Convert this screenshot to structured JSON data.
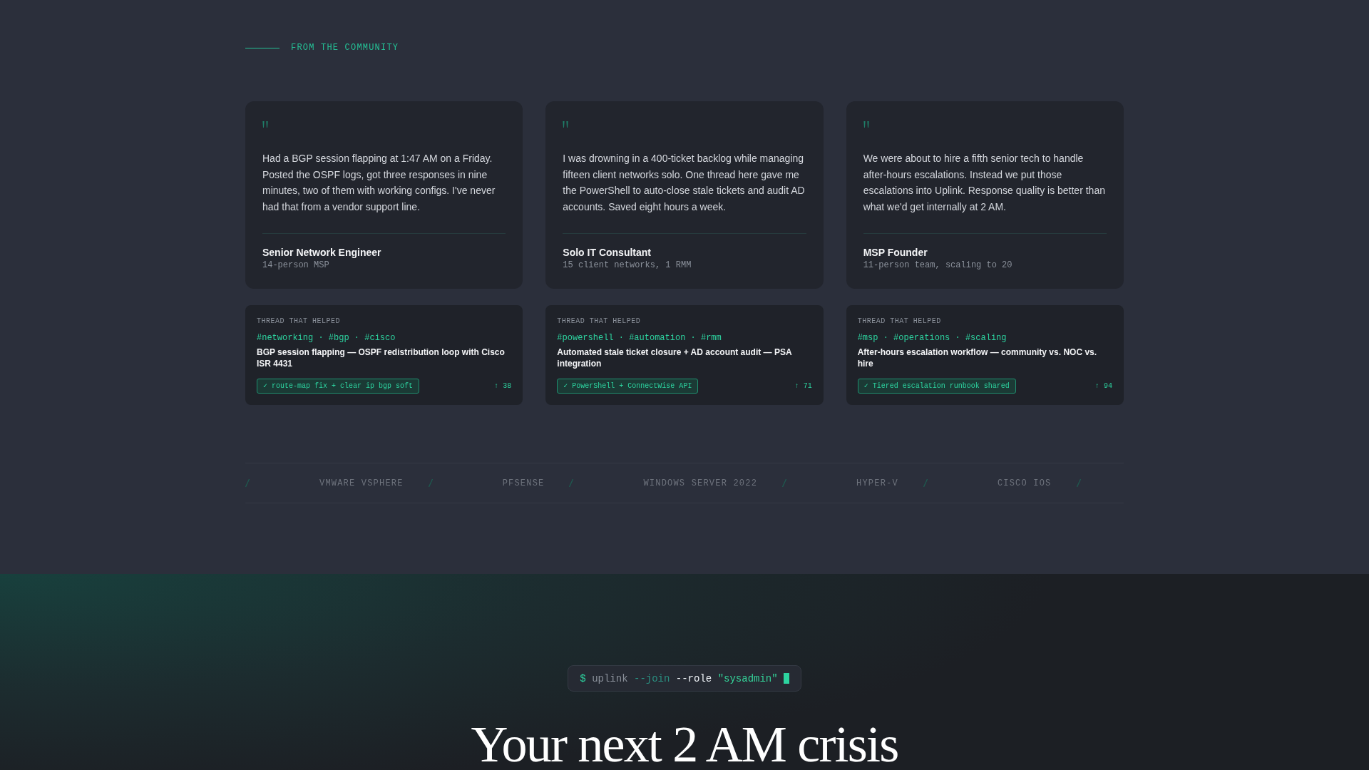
{
  "section_label": "FROM THE COMMUNITY",
  "testimonials": [
    {
      "quote": "Had a BGP session flapping at 1:47 AM on a Friday. Posted the OSPF logs, got three responses in nine minutes, two of them with working configs. I've never had that from a vendor support line.",
      "role": "Senior Network Engineer",
      "detail": "14-person MSP"
    },
    {
      "quote": "I was drowning in a 400-ticket backlog while managing fifteen client networks solo. One thread here gave me the PowerShell to auto-close stale tickets and audit AD accounts. Saved eight hours a week.",
      "role": "Solo IT Consultant",
      "detail": "15 client networks, 1 RMM"
    },
    {
      "quote": "We were about to hire a fifth senior tech to handle after-hours escalations. Instead we put those escalations into Uplink. Response quality is better than what we'd get internally at 2 AM.",
      "role": "MSP Founder",
      "detail": "11-person team, scaling to 20"
    }
  ],
  "threads": [
    {
      "label": "THREAD THAT HELPED",
      "tags": "#networking · #bgp · #cisco",
      "title": "BGP session flapping — OSPF redistribution loop with Cisco ISR 4431",
      "solution": "✓ route-map fix + clear ip bgp soft",
      "upvotes": "↑ 38"
    },
    {
      "label": "THREAD THAT HELPED",
      "tags": "#powershell · #automation · #rmm",
      "title": "Automated stale ticket closure + AD account audit — PSA integration",
      "solution": "✓ PowerShell + ConnectWise API",
      "upvotes": "↑ 71"
    },
    {
      "label": "THREAD THAT HELPED",
      "tags": "#msp · #operations · #scaling",
      "title": "After-hours escalation workflow — community vs. NOC vs. hire",
      "solution": "✓ Tiered escalation runbook shared",
      "upvotes": "↑ 94"
    }
  ],
  "tech_strip": [
    "VMWARE VSPHERE",
    "PFSENSE",
    "WINDOWS SERVER 2022",
    "HYPER-V",
    "CISCO IOS"
  ],
  "terminal": [
    {
      "kind": "prompt",
      "text": "$"
    },
    {
      "kind": "command",
      "text": "uplink"
    },
    {
      "kind": "flag",
      "text": "--join"
    },
    {
      "kind": "option",
      "text": "--role"
    },
    {
      "kind": "string",
      "text": "\"sysadmin\""
    }
  ],
  "headline": "Your next 2 AM crisis"
}
